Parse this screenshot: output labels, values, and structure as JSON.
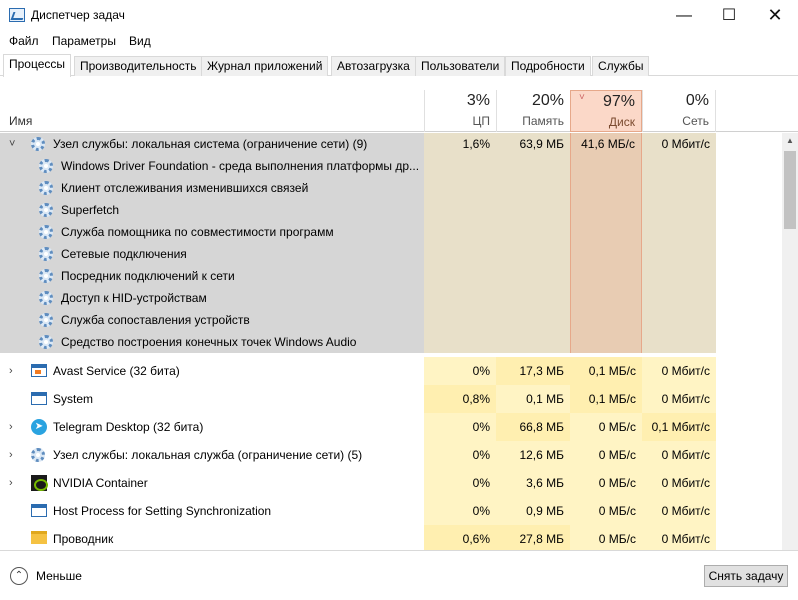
{
  "window": {
    "title": "Диспетчер задач",
    "controls": {
      "minimize": "—",
      "maximize": "☐",
      "close": "✕"
    }
  },
  "menu": [
    "Файл",
    "Параметры",
    "Вид"
  ],
  "tabs": [
    "Процессы",
    "Производительность",
    "Журнал приложений",
    "Автозагрузка",
    "Пользователи",
    "Подробности",
    "Службы"
  ],
  "active_tab": "Процессы",
  "columns": {
    "name": "Имя",
    "cpu": {
      "pct": "3%",
      "label": "ЦП"
    },
    "memory": {
      "pct": "20%",
      "label": "Память"
    },
    "disk": {
      "pct": "97%",
      "label": "Диск",
      "sorted": true
    },
    "network": {
      "pct": "0%",
      "label": "Сеть"
    }
  },
  "colors": {
    "accent": "#2b6cb0",
    "heat_light": "#fff4c4",
    "heat_medium": "#ffefb0",
    "sorted_column": "#fbd8c8",
    "selection": "#d6d6d6"
  },
  "rows": [
    {
      "name": "Узел службы: локальная система (ограничение сети) (9)",
      "icon": "gear-icon",
      "expander": "˅",
      "cpu": "1,6%",
      "mem": "63,9 МБ",
      "disk": "41,6 МБ/с",
      "net": "0 Мбит/с"
    },
    {
      "name": "Windows Driver Foundation - среда выполнения платформы др...",
      "icon": "gear-icon",
      "child": true
    },
    {
      "name": "Клиент отслеживания изменившихся связей",
      "icon": "gear-icon",
      "child": true
    },
    {
      "name": "Superfetch",
      "icon": "gear-icon",
      "child": true
    },
    {
      "name": "Служба помощника по совместимости программ",
      "icon": "gear-icon",
      "child": true
    },
    {
      "name": "Сетевые подключения",
      "icon": "gear-icon",
      "child": true
    },
    {
      "name": "Посредник подключений к сети",
      "icon": "gear-icon",
      "child": true
    },
    {
      "name": "Доступ к HID-устройствам",
      "icon": "gear-icon",
      "child": true
    },
    {
      "name": "Служба сопоставления устройств",
      "icon": "gear-icon",
      "child": true
    },
    {
      "name": "Средство построения конечных точек Windows Audio",
      "icon": "gear-icon",
      "child": true
    },
    {
      "name": "Avast Service (32 бита)",
      "icon": "avast-window-icon",
      "expander": "›",
      "cpu": "0%",
      "mem": "17,3 МБ",
      "disk": "0,1 МБ/с",
      "net": "0 Мбит/с"
    },
    {
      "name": "System",
      "icon": "system-window-icon",
      "expander": "",
      "cpu": "0,8%",
      "mem": "0,1 МБ",
      "disk": "0,1 МБ/с",
      "net": "0 Мбит/с"
    },
    {
      "name": "Telegram Desktop (32 бита)",
      "icon": "telegram-icon",
      "expander": "›",
      "cpu": "0%",
      "mem": "66,8 МБ",
      "disk": "0 МБ/с",
      "net": "0,1 Мбит/с"
    },
    {
      "name": "Узел службы: локальная служба (ограничение сети) (5)",
      "icon": "gear-icon",
      "expander": "›",
      "cpu": "0%",
      "mem": "12,6 МБ",
      "disk": "0 МБ/с",
      "net": "0 Мбит/с"
    },
    {
      "name": "NVIDIA Container",
      "icon": "nvidia-icon",
      "expander": "›",
      "cpu": "0%",
      "mem": "3,6 МБ",
      "disk": "0 МБ/с",
      "net": "0 Мбит/с"
    },
    {
      "name": "Host Process for Setting Synchronization",
      "icon": "window-icon",
      "expander": "",
      "cpu": "0%",
      "mem": "0,9 МБ",
      "disk": "0 МБ/с",
      "net": "0 Мбит/с"
    },
    {
      "name": "Проводник",
      "icon": "folder-icon",
      "expander": "",
      "cpu": "0,6%",
      "mem": "27,8 МБ",
      "disk": "0 МБ/с",
      "net": "0 Мбит/с"
    }
  ],
  "footer": {
    "less_icon": "⌃",
    "less_label": "Меньше",
    "end_task": "Снять задачу"
  }
}
